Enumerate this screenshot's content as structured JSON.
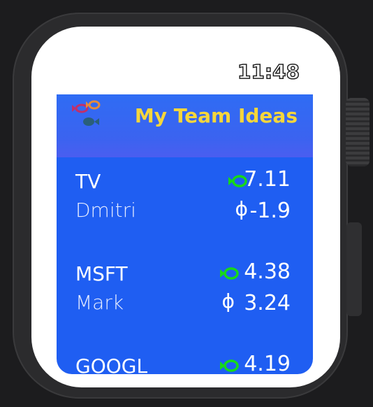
{
  "watch": {
    "time": "11:48"
  },
  "app": {
    "title": "My Team Ideas",
    "logo_icon": "fish-logo-icon",
    "colors": {
      "title": "#f5d63b",
      "list_background": "#1f5ef2",
      "rating_icon": "#17d81a"
    }
  },
  "ideas": [
    {
      "ticker": "TV",
      "owner": "Dmitri",
      "rating": "7.11",
      "change": "-1.9",
      "rating_icon": "fish-icon",
      "change_icon": "phi-icon",
      "change_glyph": "ϕ"
    },
    {
      "ticker": "MSFT",
      "owner": "Mark",
      "rating": "4.38",
      "change": "3.24",
      "rating_icon": "fish-icon",
      "change_icon": "phi-icon",
      "change_glyph": "ϕ"
    },
    {
      "ticker": "GOOGL",
      "owner": "",
      "rating": "4.19",
      "change": "",
      "rating_icon": "fish-icon",
      "change_icon": "phi-icon",
      "change_glyph": ""
    }
  ]
}
